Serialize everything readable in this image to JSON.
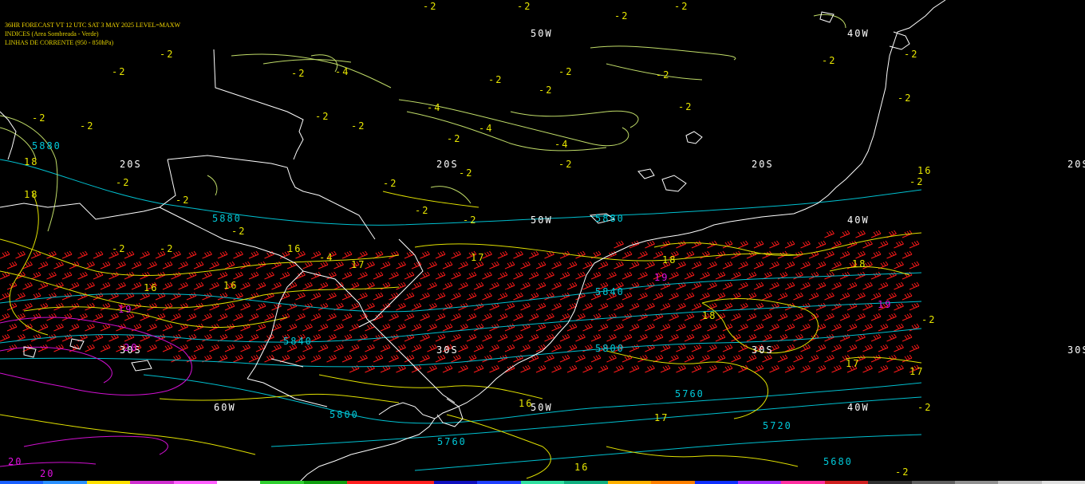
{
  "header": {
    "title": "36HR FORECAST    VT 12 UTC SAT  3 MAY 2025    LEVEL=MAXW",
    "line2": "INDICES (Area Sombreada - Verde)",
    "line3": "LINHAS DE CORRENTE (950 - 850hPa)"
  },
  "colors": {
    "background": "#000000",
    "coastline": "#ffffff",
    "height_contours": "#00c8d8",
    "index_contours": "#e8e600",
    "jet_barbs": "#ff1a1a",
    "streamlines": "#c8e070",
    "magenta_contours": "#e010e0",
    "header_text": "#e6d400"
  },
  "grid_labels": [
    {
      "text": "50W"
    },
    {
      "text": "40W"
    },
    {
      "text": "20S"
    },
    {
      "text": "20S"
    },
    {
      "text": "20S"
    },
    {
      "text": "20S"
    },
    {
      "text": "50W"
    },
    {
      "text": "40W"
    },
    {
      "text": "30S"
    },
    {
      "text": "30S"
    },
    {
      "text": "30S"
    },
    {
      "text": "30S"
    },
    {
      "text": "60W"
    },
    {
      "text": "50W"
    },
    {
      "text": "40W"
    }
  ],
  "height_labels": [
    "5880",
    "5880",
    "5880",
    "5840",
    "5840",
    "5800",
    "5800",
    "5760",
    "5760",
    "5720",
    "5680"
  ],
  "index_labels": [
    "-2",
    "-2",
    "-2",
    "-2",
    "-2",
    "-2",
    "-2",
    "-2",
    "-2",
    "-2",
    "-2",
    "-2",
    "-2",
    "-2",
    "-2",
    "-2",
    "-2",
    "-2",
    "-2",
    "-2",
    "-2",
    "-2",
    "-2",
    "-2",
    "-2",
    "-2",
    "-2",
    "-2",
    "-2",
    "-2",
    "-2",
    "-2",
    "-2",
    "-2",
    "-4",
    "-4",
    "-4",
    "-4",
    "-4",
    "18",
    "18",
    "18",
    "18",
    "18",
    "16",
    "16",
    "16",
    "16",
    "16",
    "16",
    "17",
    "17",
    "17",
    "17",
    "17",
    "19",
    "19",
    "19",
    "20",
    "20",
    "20"
  ]
}
